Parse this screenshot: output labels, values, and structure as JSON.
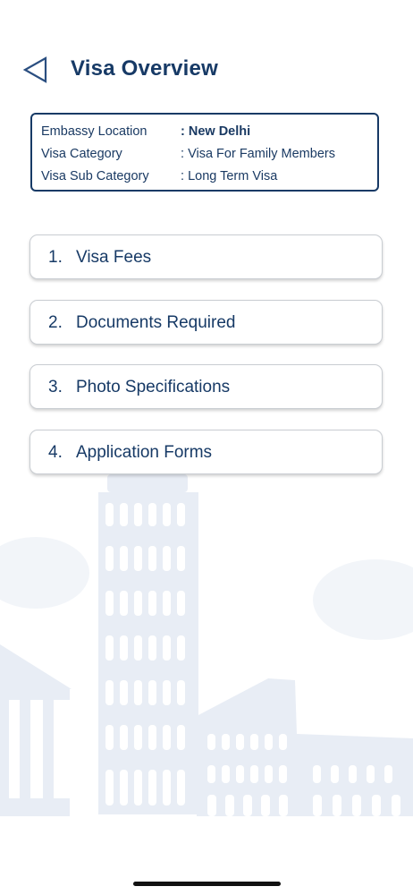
{
  "header": {
    "title": "Visa Overview",
    "back_icon": "back-triangle-icon"
  },
  "details": {
    "rows": [
      {
        "label": "Embassy Location",
        "value": "New Delhi"
      },
      {
        "label": "Visa Category",
        "value": "Visa For Family Members"
      },
      {
        "label": "Visa Sub Category",
        "value": "Long Term Visa"
      }
    ]
  },
  "menu": {
    "items": [
      {
        "number": "1.",
        "label": "Visa Fees"
      },
      {
        "number": "2.",
        "label": "Documents Required"
      },
      {
        "number": "3.",
        "label": "Photo Specifications"
      },
      {
        "number": "4.",
        "label": "Application Forms"
      }
    ]
  },
  "colors": {
    "primary": "#173a66",
    "card_border": "#c9cdd2",
    "background_art": "#e6ecf4"
  }
}
